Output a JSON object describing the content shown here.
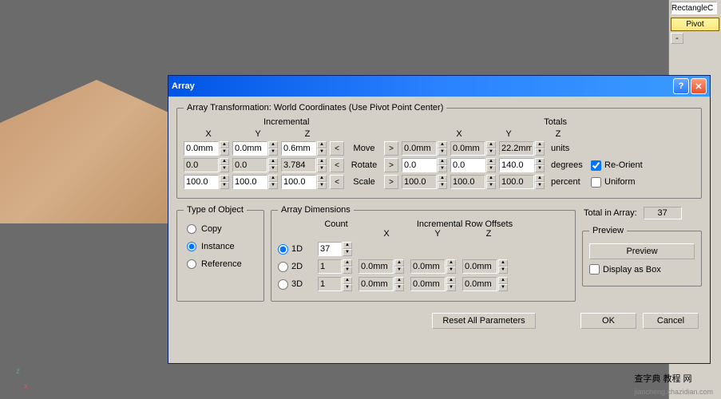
{
  "rightPanel": {
    "objectName": "RectangleC",
    "pivot": "Pivot"
  },
  "dialog": {
    "title": "Array",
    "transformGroup": {
      "legend": "Array Transformation: World Coordinates (Use Pivot Point Center)",
      "incrementalLabel": "Incremental",
      "totalsLabel": "Totals",
      "x": "X",
      "y": "Y",
      "z": "Z",
      "move": {
        "label": "Move",
        "unit": "units",
        "ix": "0.0mm",
        "iy": "0.0mm",
        "iz": "0.6mm",
        "tx": "0.0mm",
        "ty": "0.0mm",
        "tz": "22.2mm"
      },
      "rotate": {
        "label": "Rotate",
        "unit": "degrees",
        "ix": "0.0",
        "iy": "0.0",
        "iz": "3.784",
        "tx": "0.0",
        "ty": "0.0",
        "tz": "140.0",
        "reorient": "Re-Orient"
      },
      "scale": {
        "label": "Scale",
        "unit": "percent",
        "ix": "100.0",
        "iy": "100.0",
        "iz": "100.0",
        "tx": "100.0",
        "ty": "100.0",
        "tz": "100.0",
        "uniform": "Uniform"
      }
    },
    "typeGroup": {
      "legend": "Type of Object",
      "copy": "Copy",
      "instance": "Instance",
      "reference": "Reference"
    },
    "dimGroup": {
      "legend": "Array Dimensions",
      "countLabel": "Count",
      "rowOffsetLabel": "Incremental Row Offsets",
      "x": "X",
      "y": "Y",
      "z": "Z",
      "d1": {
        "label": "1D",
        "count": "37"
      },
      "d2": {
        "label": "2D",
        "count": "1",
        "x": "0.0mm",
        "y": "0.0mm",
        "z": "0.0mm"
      },
      "d3": {
        "label": "3D",
        "count": "1",
        "x": "0.0mm",
        "y": "0.0mm",
        "z": "0.0mm"
      }
    },
    "totalInArray": {
      "label": "Total in Array:",
      "value": "37"
    },
    "previewGroup": {
      "legend": "Preview",
      "button": "Preview",
      "displayBox": "Display as Box"
    },
    "buttons": {
      "reset": "Reset All Parameters",
      "ok": "OK",
      "cancel": "Cancel"
    }
  },
  "watermark": {
    "main": "查字典 教程 网",
    "sub": "jiaocheng.chazidian.com"
  }
}
